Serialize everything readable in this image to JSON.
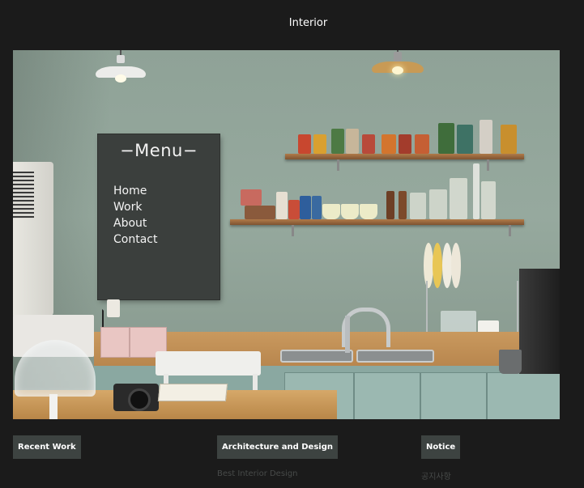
{
  "site": {
    "title": "Interior"
  },
  "menu": {
    "title": "−Menu−",
    "items": [
      {
        "label": "Home"
      },
      {
        "label": "Work"
      },
      {
        "label": "About"
      },
      {
        "label": "Contact"
      }
    ]
  },
  "sections": [
    {
      "label": "Recent Work",
      "subtitle": ""
    },
    {
      "label": "Architecture and Design",
      "subtitle": "Best Interior Design"
    },
    {
      "label": "Notice",
      "subtitle": "공지사항"
    }
  ],
  "colors": {
    "page_background": "#1b1b1b",
    "menu_board": "#3b3f3d",
    "section_button": "#3d4341",
    "subtitle_text": "#474a49"
  }
}
